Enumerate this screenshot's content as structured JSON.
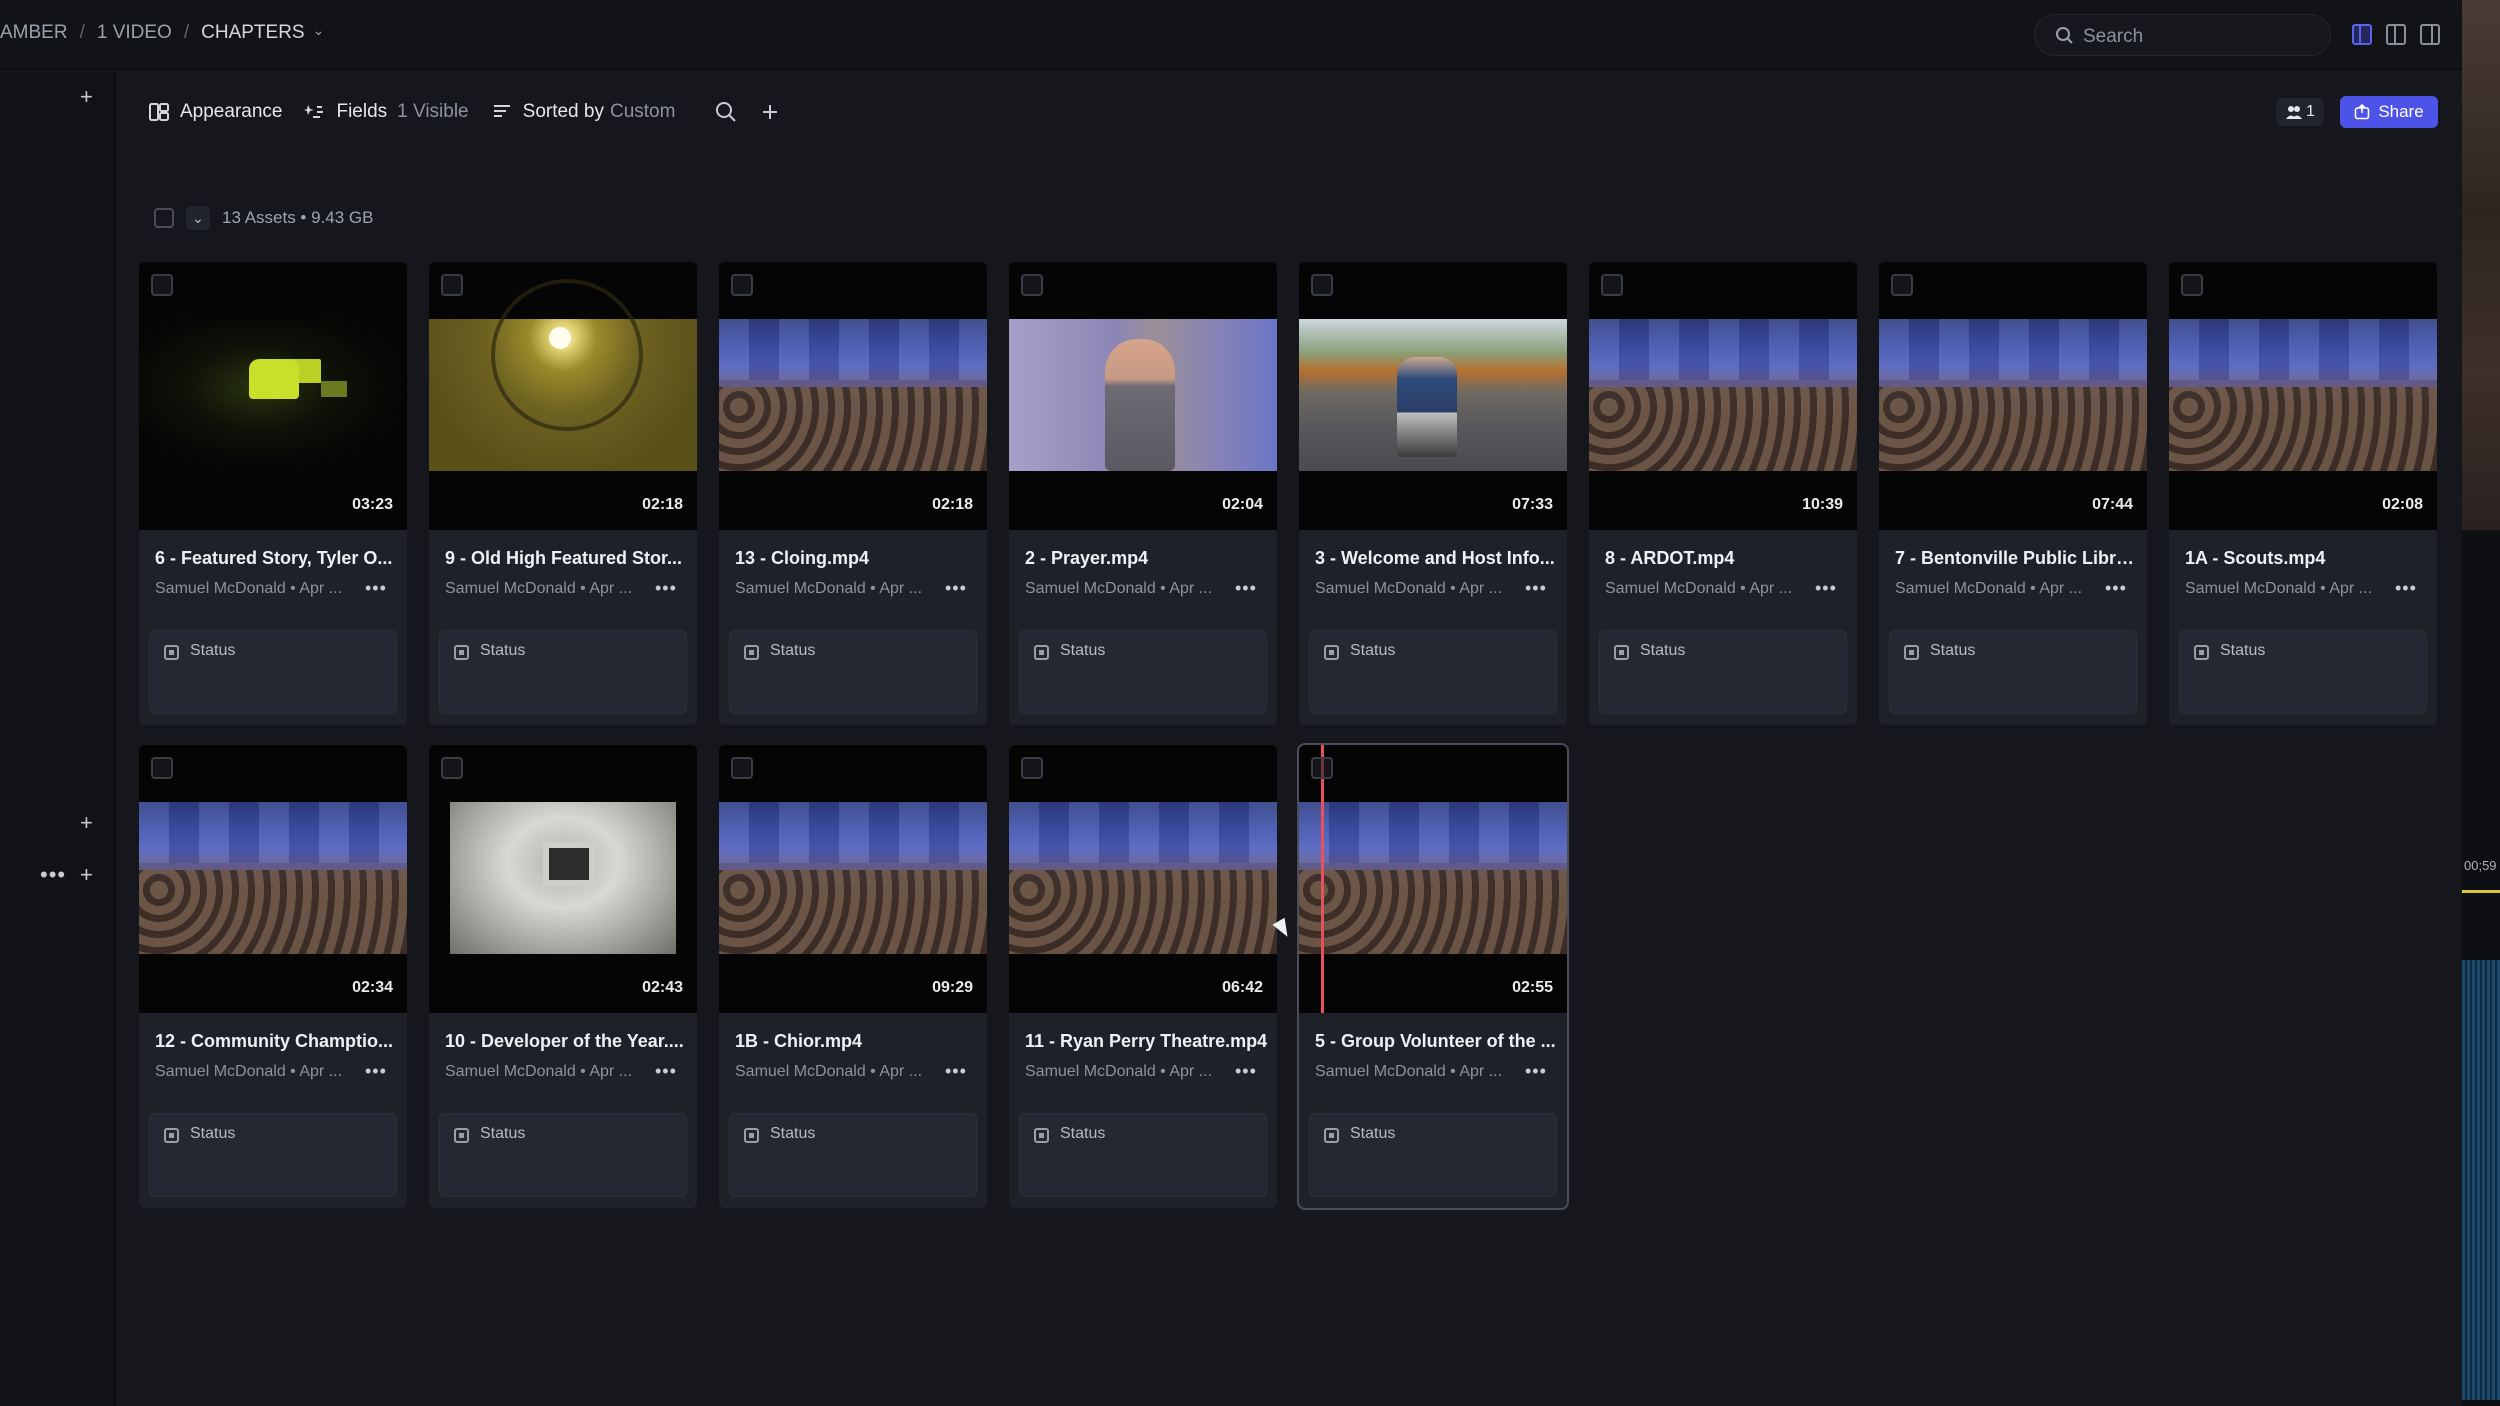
{
  "breadcrumb": {
    "items": [
      "AMBER",
      "1 VIDEO",
      "CHAPTERS"
    ]
  },
  "search": {
    "placeholder": "Search"
  },
  "toolbar": {
    "appearance": "Appearance",
    "fields": "Fields",
    "fields_count": "1 Visible",
    "sorted_by": "Sorted by",
    "sorted_value": "Custom"
  },
  "collaborators": {
    "count": "1"
  },
  "share": {
    "label": "Share"
  },
  "assets": {
    "summary": "13 Assets • 9.43 GB"
  },
  "cards": [
    {
      "title": "6 - Featured Story, Tyler O...",
      "meta": "Samuel McDonald • Apr ...",
      "duration": "03:23",
      "status": "Status",
      "thumb": "dark"
    },
    {
      "title": "9 - Old High Featured Stor...",
      "meta": "Samuel McDonald • Apr ...",
      "duration": "02:18",
      "status": "Status",
      "thumb": "dome"
    },
    {
      "title": "13 - Cloing.mp4",
      "meta": "Samuel McDonald • Apr ...",
      "duration": "02:18",
      "status": "Status",
      "thumb": "stage"
    },
    {
      "title": "2 - Prayer.mp4",
      "meta": "Samuel McDonald • Apr ...",
      "duration": "02:04",
      "status": "Status",
      "thumb": "pray"
    },
    {
      "title": "3 - Welcome and Host Info...",
      "meta": "Samuel McDonald • Apr ...",
      "duration": "07:33",
      "status": "Status",
      "thumb": "street"
    },
    {
      "title": "8 - ARDOT.mp4",
      "meta": "Samuel McDonald • Apr ...",
      "duration": "10:39",
      "status": "Status",
      "thumb": "stage"
    },
    {
      "title": "7 - Bentonville Public Libra...",
      "meta": "Samuel McDonald • Apr ...",
      "duration": "07:44",
      "status": "Status",
      "thumb": "stage"
    },
    {
      "title": "1A - Scouts.mp4",
      "meta": "Samuel McDonald • Apr ...",
      "duration": "02:08",
      "status": "Status",
      "thumb": "stage"
    },
    {
      "title": "12 - Community Champtio...",
      "meta": "Samuel McDonald • Apr ...",
      "duration": "02:34",
      "status": "Status",
      "thumb": "stage"
    },
    {
      "title": "10 - Developer of the Year....",
      "meta": "Samuel McDonald • Apr ...",
      "duration": "02:43",
      "status": "Status",
      "thumb": "hall"
    },
    {
      "title": "1B - Chior.mp4",
      "meta": "Samuel McDonald • Apr ...",
      "duration": "09:29",
      "status": "Status",
      "thumb": "stage"
    },
    {
      "title": "11 - Ryan Perry Theatre.mp4",
      "meta": "Samuel McDonald • Apr ...",
      "duration": "06:42",
      "status": "Status",
      "thumb": "stage"
    },
    {
      "title": "5 - Group Volunteer of the ...",
      "meta": "Samuel McDonald • Apr ...",
      "duration": "02:55",
      "status": "Status",
      "thumb": "stage"
    }
  ],
  "side_timeline": {
    "time_label": "00;59"
  },
  "colors": {
    "accent": "#4c53e6",
    "background": "#16171c",
    "card": "#1f2128",
    "playhead": "#e8505b"
  }
}
